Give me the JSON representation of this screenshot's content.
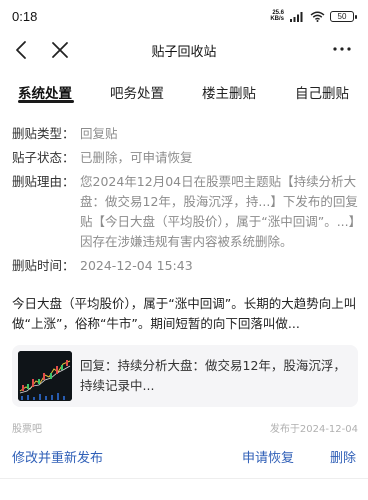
{
  "status_bar": {
    "time": "0:18",
    "net_speed_value": "25.6",
    "net_speed_unit": "KB/s",
    "battery": "50"
  },
  "nav": {
    "title": "贴子回收站"
  },
  "tabs": [
    {
      "label": "系统处置",
      "active": true
    },
    {
      "label": "吧务处置",
      "active": false
    },
    {
      "label": "楼主删贴",
      "active": false
    },
    {
      "label": "自己删贴",
      "active": false
    }
  ],
  "info": {
    "type_label": "删贴类型：",
    "type_value": "回复贴",
    "status_label": "贴子状态：",
    "status_value": "已删除，可申请恢复",
    "reason_label": "删贴理由：",
    "reason_value": "您2024年12月04日在股票吧主题贴【持续分析大盘：做交易12年，股海沉浮，持...】下发布的回复贴【今日大盘（平均股价），属于“涨中回调”。...】因存在涉嫌违规有害内容被系统删除。",
    "time_label": "删贴时间：",
    "time_value": "2024-12-04 15:43"
  },
  "content": {
    "text": "今日大盘（平均股价），属于“涨中回调”。长期的大趋势向上叫做“上涨”，俗称“牛市”。期间短暂的向下回落叫做..."
  },
  "quote": {
    "text": "回复：持续分析大盘：做交易12年，股海沉浮，持续记录中..."
  },
  "meta": {
    "source": "股票吧",
    "published": "发布于2024-12-04"
  },
  "actions": {
    "edit_label": "修改并重新发布",
    "appeal_label": "申请恢复",
    "delete_label": "删除"
  }
}
